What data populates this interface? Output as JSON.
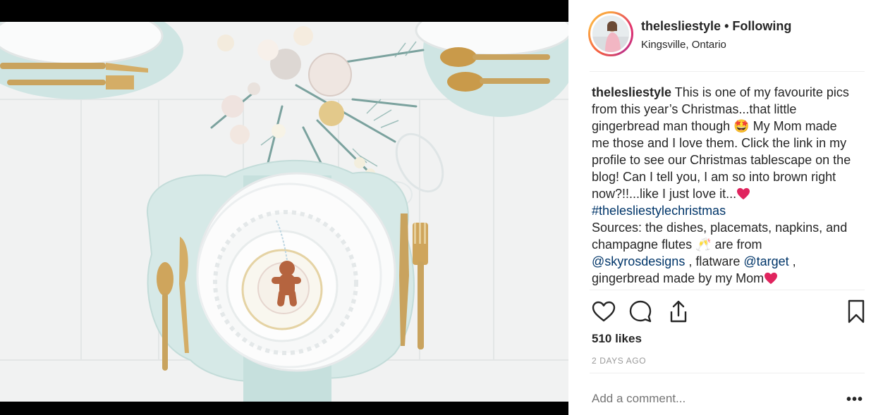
{
  "post": {
    "username": "thelesliestyle",
    "separator": "•",
    "follow_status": "Following",
    "location": "Kingsville, Ontario"
  },
  "caption": {
    "username": "thelesliestyle",
    "text_1": " This is one of my favourite pics from this year’s Christmas...that little gingerbread man though ",
    "emoji_1": "🤩",
    "text_2": " My Mom made me those and I love them. Click the link in my profile to see our Christmas tablescape on the blog! Can I tell you, I am so into brown right now?!!...like I just love it...",
    "hashtag": "#thelesliestylechristmas",
    "text_3": "Sources: the dishes, placemats, napkins, and champagne flutes ",
    "emoji_2": "🥂",
    "text_4": " are from ",
    "mention_1": "@skyrosdesigns",
    "text_5": " , flatware ",
    "mention_2": "@target",
    "text_6": " , gingerbread made by my Mom"
  },
  "stats": {
    "likes": "510 likes",
    "time": "2 DAYS AGO"
  },
  "comment": {
    "placeholder": "Add a comment..."
  },
  "more_label": "•••",
  "icons": {
    "like": "heart-icon",
    "comment": "comment-bubble-icon",
    "share": "share-icon",
    "save": "bookmark-icon"
  },
  "colors": {
    "link": "#003569",
    "heart": "#e0245e",
    "muted": "#999999",
    "text": "#262626"
  }
}
